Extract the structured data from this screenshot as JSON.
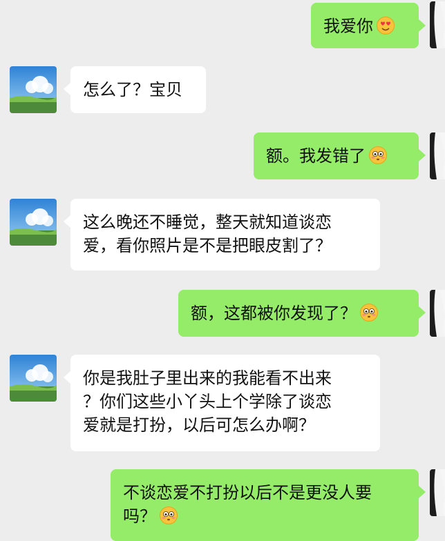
{
  "messages": [
    {
      "side": "out",
      "text": "我爱你",
      "emoji": "heart-eyes-emoji"
    },
    {
      "side": "in",
      "text": "怎么了？宝贝"
    },
    {
      "side": "out",
      "text": "额。我发错了",
      "emoji": "flushed-emoji"
    },
    {
      "side": "in",
      "text": "这么晚还不睡觉，整天就知道谈恋\n爱，看你照片是不是把眼皮割了？"
    },
    {
      "side": "out",
      "text": "额，这都被你发现了？",
      "emoji": "flushed-emoji"
    },
    {
      "side": "in",
      "text": "你是我肚子里出来的我能看不出来\n？你们这些小丫头上个学除了谈恋\n爱就是打扮，以后可怎么办啊？"
    },
    {
      "side": "out",
      "text": "不谈恋爱不打扮以后不是更没人要\n吗？",
      "emoji": "flushed-emoji"
    }
  ],
  "colors": {
    "background": "#ededed",
    "incoming_bubble": "#ffffff",
    "outgoing_bubble": "#95ec69"
  }
}
